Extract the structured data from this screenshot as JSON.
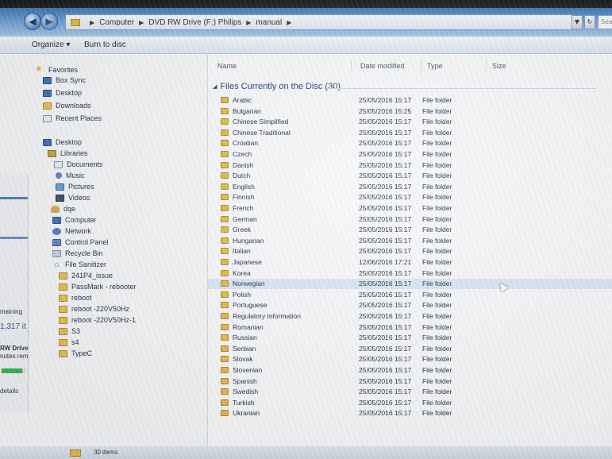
{
  "address": {
    "crumbs": [
      "Computer",
      "DVD RW Drive (F:) Philips",
      "manual"
    ],
    "search_placeholder": "Sea"
  },
  "toolbar": {
    "organize_label": "Organize ▾",
    "burn_label": "Burn to disc"
  },
  "nav": {
    "favorites": "Favorites",
    "box_sync": "Box Sync",
    "desktop_fav": "Desktop",
    "downloads": "Downloads",
    "recent_places": "Recent Places",
    "desktop": "Desktop",
    "libraries": "Libraries",
    "documents": "Documents",
    "music": "Music",
    "pictures": "Pictures",
    "videos": "Videos",
    "user": "dqe",
    "computer": "Computer",
    "network": "Network",
    "control_panel": "Control Panel",
    "recycle_bin": "Recycle Bin",
    "file_sanitizer": "File Sanitizer",
    "issue": "241P4_issue",
    "passmark": "PassMark - rebooter",
    "reboot": "reboot",
    "reboot_220": "reboot -220V50Hz",
    "reboot_220_1": "reboot -220V50Hz-1",
    "s3": "S3",
    "s4": "s4",
    "typec": "TypeC"
  },
  "background_window": {
    "remaining": "maining",
    "items": "1,317 it",
    "drive": "RW Drive (",
    "minutes": "nutes rema",
    "details": "details",
    "progress": 0.85
  },
  "columns": {
    "name": "Name",
    "date": "Date modified",
    "type": "Type",
    "size": "Size"
  },
  "group_title": "Files Currently on the Disc (30)",
  "files": [
    {
      "name": "Arabic",
      "date": "25/05/2016 15:17",
      "type": "File folder"
    },
    {
      "name": "Bulgarian",
      "date": "25/05/2016 15:25",
      "type": "File folder"
    },
    {
      "name": "Chinese Simplified",
      "date": "25/05/2016 15:17",
      "type": "File folder"
    },
    {
      "name": "Chinese Traditional",
      "date": "25/05/2016 15:17",
      "type": "File folder"
    },
    {
      "name": "Croatian",
      "date": "25/05/2016 15:17",
      "type": "File folder"
    },
    {
      "name": "Czech",
      "date": "25/05/2016 15:17",
      "type": "File folder"
    },
    {
      "name": "Danish",
      "date": "25/05/2016 15:17",
      "type": "File folder"
    },
    {
      "name": "Dutch",
      "date": "25/05/2016 15:17",
      "type": "File folder"
    },
    {
      "name": "English",
      "date": "25/05/2016 15:17",
      "type": "File folder"
    },
    {
      "name": "Finnish",
      "date": "25/05/2016 15:17",
      "type": "File folder"
    },
    {
      "name": "French",
      "date": "25/05/2016 15:17",
      "type": "File folder"
    },
    {
      "name": "German",
      "date": "25/05/2016 15:17",
      "type": "File folder"
    },
    {
      "name": "Greek",
      "date": "25/05/2016 15:17",
      "type": "File folder"
    },
    {
      "name": "Hungarian",
      "date": "25/05/2016 15:17",
      "type": "File folder"
    },
    {
      "name": "Italian",
      "date": "25/05/2016 15:17",
      "type": "File folder"
    },
    {
      "name": "Japanese",
      "date": "12/06/2016 17:21",
      "type": "File folder"
    },
    {
      "name": "Korea",
      "date": "25/05/2016 15:17",
      "type": "File folder"
    },
    {
      "name": "Norwegian",
      "date": "25/05/2016 15:17",
      "type": "File folder"
    },
    {
      "name": "Polish",
      "date": "25/05/2016 15:17",
      "type": "File folder"
    },
    {
      "name": "Portuguese",
      "date": "25/05/2016 15:17",
      "type": "File folder"
    },
    {
      "name": "Regulatory Information",
      "date": "25/05/2016 15:17",
      "type": "File folder"
    },
    {
      "name": "Romanian",
      "date": "25/05/2016 15:17",
      "type": "File folder"
    },
    {
      "name": "Russian",
      "date": "25/05/2016 15:17",
      "type": "File folder"
    },
    {
      "name": "Serbian",
      "date": "25/05/2016 15:17",
      "type": "File folder"
    },
    {
      "name": "Slovak",
      "date": "25/05/2016 15:17",
      "type": "File folder"
    },
    {
      "name": "Slovenian",
      "date": "25/05/2016 15:17",
      "type": "File folder"
    },
    {
      "name": "Spanish",
      "date": "25/05/2016 15:17",
      "type": "File folder"
    },
    {
      "name": "Swedish",
      "date": "25/05/2016 15:17",
      "type": "File folder"
    },
    {
      "name": "Turkish",
      "date": "25/05/2016 15:17",
      "type": "File folder"
    },
    {
      "name": "Ukranian",
      "date": "25/05/2016 15:17",
      "type": "File folder"
    }
  ],
  "status": {
    "count": "30 items"
  }
}
